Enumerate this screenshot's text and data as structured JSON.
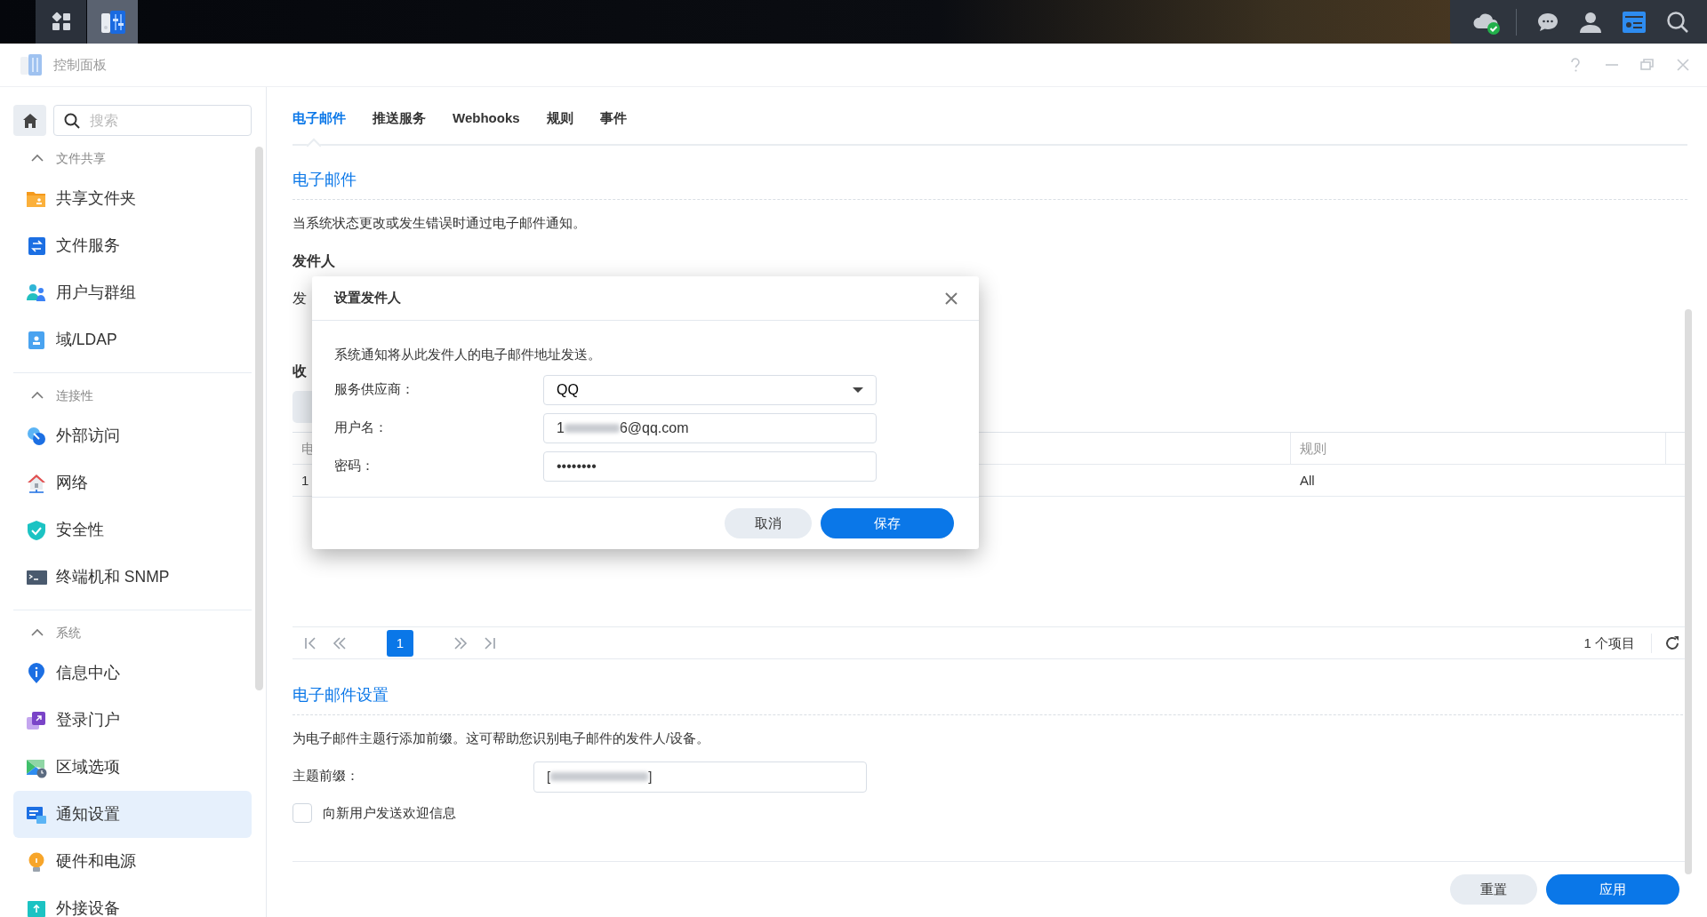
{
  "taskbar": {
    "apps": [
      {
        "kind": "grid",
        "selected": false
      },
      {
        "kind": "panel",
        "selected": true
      }
    ],
    "tray": [
      {
        "kind": "cloud-ok"
      },
      {
        "kind": "chat"
      },
      {
        "kind": "user"
      },
      {
        "kind": "widgets"
      },
      {
        "kind": "search"
      }
    ]
  },
  "window": {
    "title": "控制面板",
    "controls": [
      {
        "kind": "help"
      },
      {
        "kind": "minimize"
      },
      {
        "kind": "restore"
      },
      {
        "kind": "close"
      }
    ]
  },
  "sidebar": {
    "search": {
      "placeholder": "搜索"
    },
    "sections": [
      {
        "title": "文件共享",
        "expanded": true,
        "items": [
          {
            "label": "共享文件夹",
            "kind": "folder",
            "selected": false
          },
          {
            "label": "文件服务",
            "kind": "file-service",
            "selected": false
          },
          {
            "label": "用户与群组",
            "kind": "users",
            "selected": false
          },
          {
            "label": "域/LDAP",
            "kind": "directory",
            "selected": false
          }
        ]
      },
      {
        "title": "连接性",
        "expanded": true,
        "items": [
          {
            "label": "外部访问",
            "kind": "external",
            "selected": false
          },
          {
            "label": "网络",
            "kind": "network",
            "selected": false
          },
          {
            "label": "安全性",
            "kind": "security",
            "selected": false
          },
          {
            "label": "终端机和 SNMP",
            "kind": "terminal",
            "selected": false
          }
        ]
      },
      {
        "title": "系统",
        "expanded": true,
        "items": [
          {
            "label": "信息中心",
            "kind": "info",
            "selected": false
          },
          {
            "label": "登录门户",
            "kind": "portal",
            "selected": false
          },
          {
            "label": "区域选项",
            "kind": "region",
            "selected": false
          },
          {
            "label": "通知设置",
            "kind": "notification",
            "selected": true
          },
          {
            "label": "硬件和电源",
            "kind": "hardware",
            "selected": false
          },
          {
            "label": "外接设备",
            "kind": "devices",
            "selected": false
          }
        ]
      }
    ]
  },
  "tabs": [
    {
      "label": "电子邮件",
      "selected": true
    },
    {
      "label": "推送服务",
      "selected": false
    },
    {
      "label": "Webhooks",
      "selected": false
    },
    {
      "label": "规则",
      "selected": false
    },
    {
      "label": "事件",
      "selected": false
    }
  ],
  "email": {
    "heading": "电子邮件",
    "description": "当系统状态更改或发生错误时通过电子邮件通知。",
    "sender_heading": "发件人",
    "sender_fragment": "发",
    "recipients_fragment": "收",
    "table": {
      "columns": [
        {
          "label": "电"
        },
        {
          "label": "规则"
        }
      ],
      "rows": [
        [
          "1",
          "All"
        ]
      ]
    },
    "pagination": {
      "pages": [
        {
          "label": "1",
          "selected": true
        }
      ],
      "count": "1 个项目"
    }
  },
  "email_settings": {
    "heading": "电子邮件设置",
    "description": "为电子邮件主题行添加前缀。这可帮助您识别电子邮件的发件人/设备。",
    "subject_prefix": {
      "label": "主题前缀：",
      "value_start": "[",
      "value_end": "]"
    },
    "welcome": {
      "label": "向新用户发送欢迎信息",
      "checked": false
    }
  },
  "footer": {
    "buttons": [
      {
        "label": "重置",
        "kind": "secondary"
      },
      {
        "label": "应用",
        "kind": "primary"
      }
    ]
  },
  "dialog": {
    "title": "设置发件人",
    "description": "系统通知将从此发件人的电子邮件地址发送。",
    "fields": [
      {
        "label": "服务供应商：",
        "kind": "select",
        "value": "QQ"
      },
      {
        "label": "用户名：",
        "kind": "text",
        "value_start": "1",
        "value_end": "6@qq.com"
      },
      {
        "label": "密码：",
        "kind": "password",
        "value": "••••••••"
      }
    ],
    "buttons": [
      {
        "label": "取消",
        "kind": "secondary"
      },
      {
        "label": "保存",
        "kind": "primary"
      }
    ]
  }
}
